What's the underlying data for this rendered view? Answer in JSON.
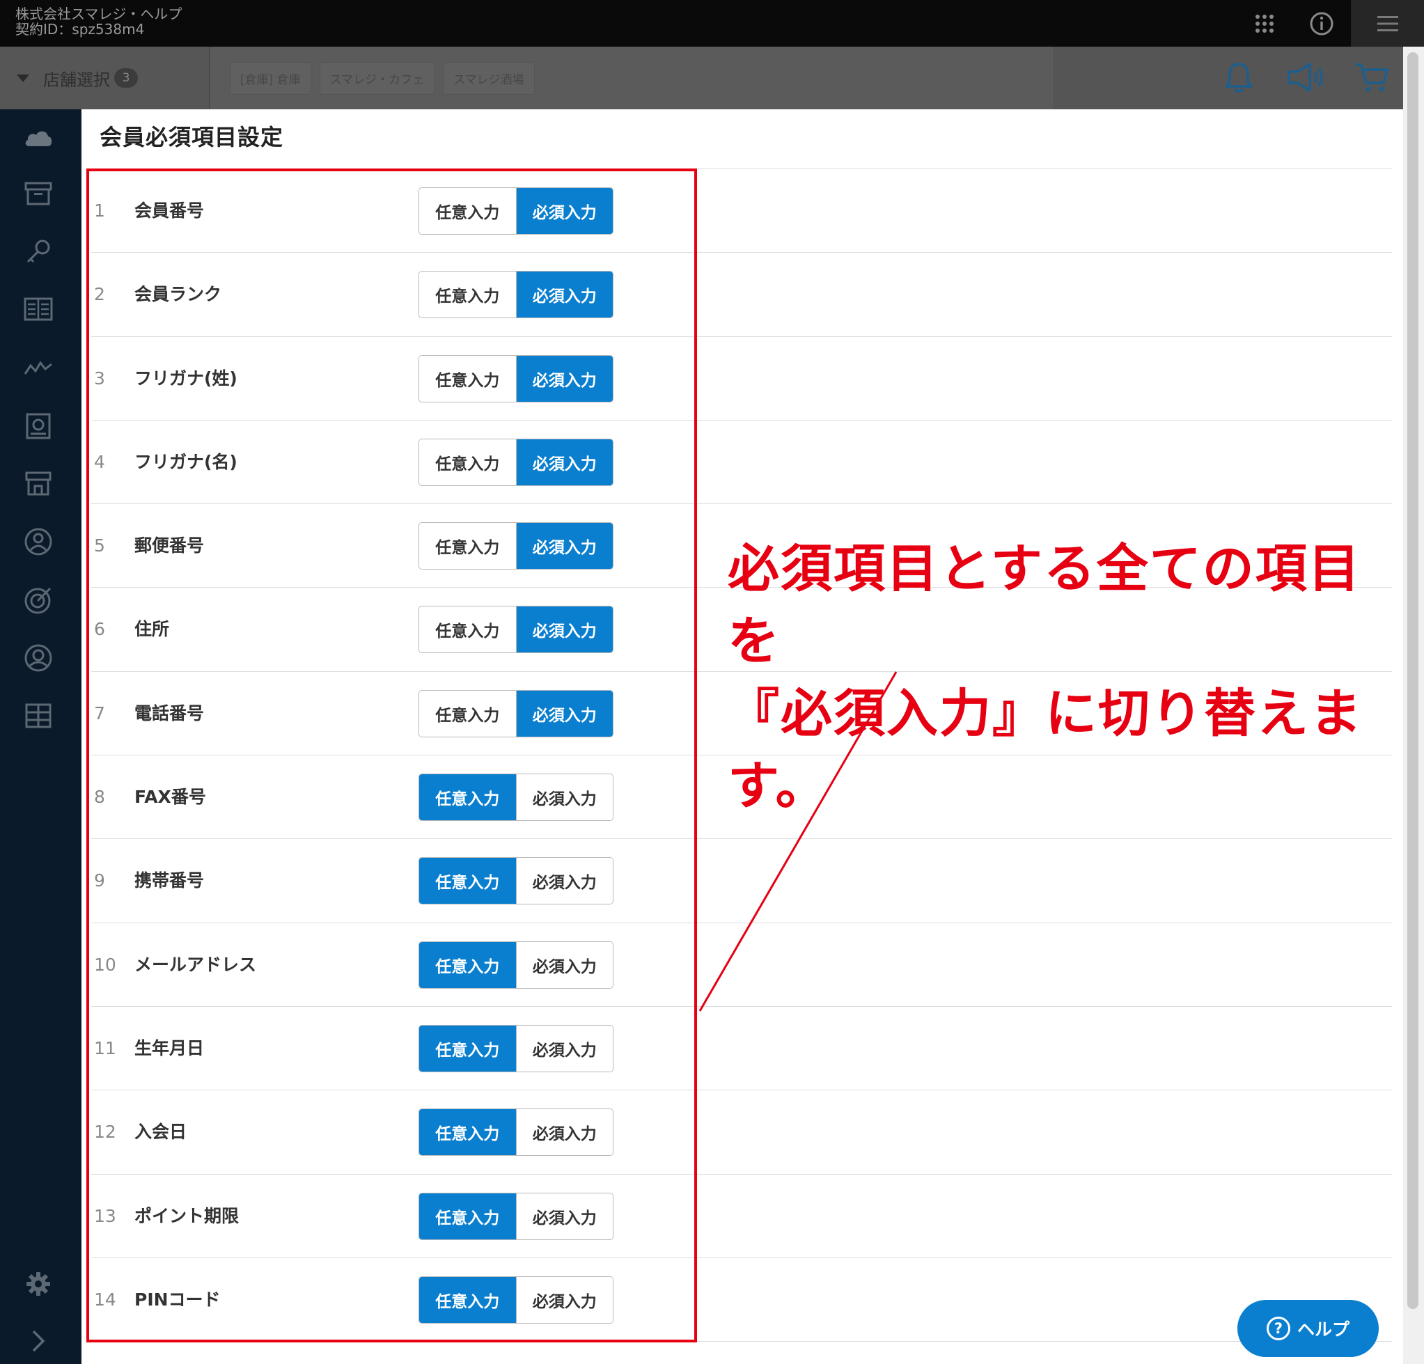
{
  "header": {
    "company_name": "株式会社スマレジ・ヘルプ",
    "contract_id": "契約ID：spz538m4"
  },
  "store_bar": {
    "select_label": "店舗選択",
    "select_count": "3",
    "chips": [
      "[倉庫] 倉庫",
      "スマレジ・カフェ",
      "スマレジ酒場"
    ]
  },
  "page": {
    "title": "会員必須項目設定"
  },
  "rows": [
    {
      "num": "1",
      "label": "会員番号",
      "optional": "任意入力",
      "required": "必須入力",
      "selected": "required"
    },
    {
      "num": "2",
      "label": "会員ランク",
      "optional": "任意入力",
      "required": "必須入力",
      "selected": "required"
    },
    {
      "num": "3",
      "label": "フリガナ(姓)",
      "optional": "任意入力",
      "required": "必須入力",
      "selected": "required"
    },
    {
      "num": "4",
      "label": "フリガナ(名)",
      "optional": "任意入力",
      "required": "必須入力",
      "selected": "required"
    },
    {
      "num": "5",
      "label": "郵便番号",
      "optional": "任意入力",
      "required": "必須入力",
      "selected": "required"
    },
    {
      "num": "6",
      "label": "住所",
      "optional": "任意入力",
      "required": "必須入力",
      "selected": "required"
    },
    {
      "num": "7",
      "label": "電話番号",
      "optional": "任意入力",
      "required": "必須入力",
      "selected": "required"
    },
    {
      "num": "8",
      "label": "FAX番号",
      "optional": "任意入力",
      "required": "必須入力",
      "selected": "optional"
    },
    {
      "num": "9",
      "label": "携帯番号",
      "optional": "任意入力",
      "required": "必須入力",
      "selected": "optional"
    },
    {
      "num": "10",
      "label": "メールアドレス",
      "optional": "任意入力",
      "required": "必須入力",
      "selected": "optional"
    },
    {
      "num": "11",
      "label": "生年月日",
      "optional": "任意入力",
      "required": "必須入力",
      "selected": "optional"
    },
    {
      "num": "12",
      "label": "入会日",
      "optional": "任意入力",
      "required": "必須入力",
      "selected": "optional"
    },
    {
      "num": "13",
      "label": "ポイント期限",
      "optional": "任意入力",
      "required": "必須入力",
      "selected": "optional"
    },
    {
      "num": "14",
      "label": "PINコード",
      "optional": "任意入力",
      "required": "必須入力",
      "selected": "optional"
    }
  ],
  "annotation": {
    "line1": "必須項目とする全ての項目を",
    "line2": "『必須入力』に切り替えます。"
  },
  "help": {
    "label": "ヘルプ"
  },
  "colors": {
    "accent": "#0a7fcf",
    "annotation": "#e60012",
    "sidebar": "#0b1a2a",
    "topbar": "#0a0a0a"
  },
  "icons": {
    "sidebar": [
      "cloud-icon",
      "archive-icon",
      "key-icon",
      "ledger-icon",
      "activity-chart-icon",
      "report-icon",
      "store-icon",
      "user-circle-icon",
      "target-icon",
      "member-icon",
      "grid-table-icon"
    ],
    "sidebar_bottom": [
      "gear-icon",
      "chevron-right-icon"
    ],
    "top": [
      "apps-grid-icon",
      "info-icon",
      "hamburger-menu-icon"
    ],
    "tools": [
      "bell-icon",
      "megaphone-icon",
      "cart-icon"
    ]
  }
}
